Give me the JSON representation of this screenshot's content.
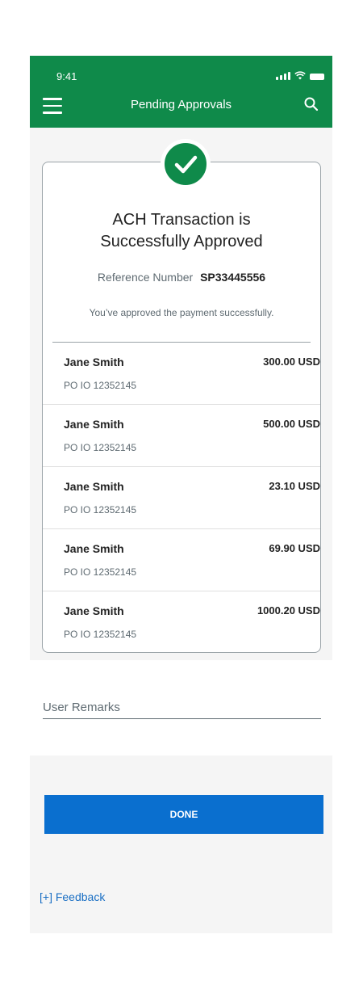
{
  "status_bar": {
    "time": "9:41"
  },
  "header": {
    "title": "Pending Approvals"
  },
  "confirmation": {
    "title_line1": "ACH Transaction is",
    "title_line2": "Successfully Approved",
    "reference_label": "Reference Number",
    "reference_value": "SP33445556",
    "message": "You’ve approved the payment successfully."
  },
  "transactions": [
    {
      "name": "Jane Smith",
      "reference": "PO IO 12352145",
      "amount": "300.00 USD"
    },
    {
      "name": "Jane Smith",
      "reference": "PO IO 12352145",
      "amount": "500.00 USD"
    },
    {
      "name": "Jane Smith",
      "reference": "PO IO 12352145",
      "amount": "23.10 USD"
    },
    {
      "name": "Jane Smith",
      "reference": "PO IO 12352145",
      "amount": "69.90 USD"
    },
    {
      "name": "Jane Smith",
      "reference": "PO IO 12352145",
      "amount": "1000.20 USD"
    }
  ],
  "remarks": {
    "label": "User Remarks"
  },
  "actions": {
    "done_label": "DONE"
  },
  "feedback": {
    "label": "[+] Feedback"
  },
  "colors": {
    "brand_green": "#0f8a4a",
    "primary_blue": "#0a6fcf",
    "link_blue": "#1a6fc4"
  },
  "icons": [
    "menu-icon",
    "search-icon",
    "checkmark-icon",
    "signal-icon",
    "wifi-icon",
    "battery-icon"
  ]
}
